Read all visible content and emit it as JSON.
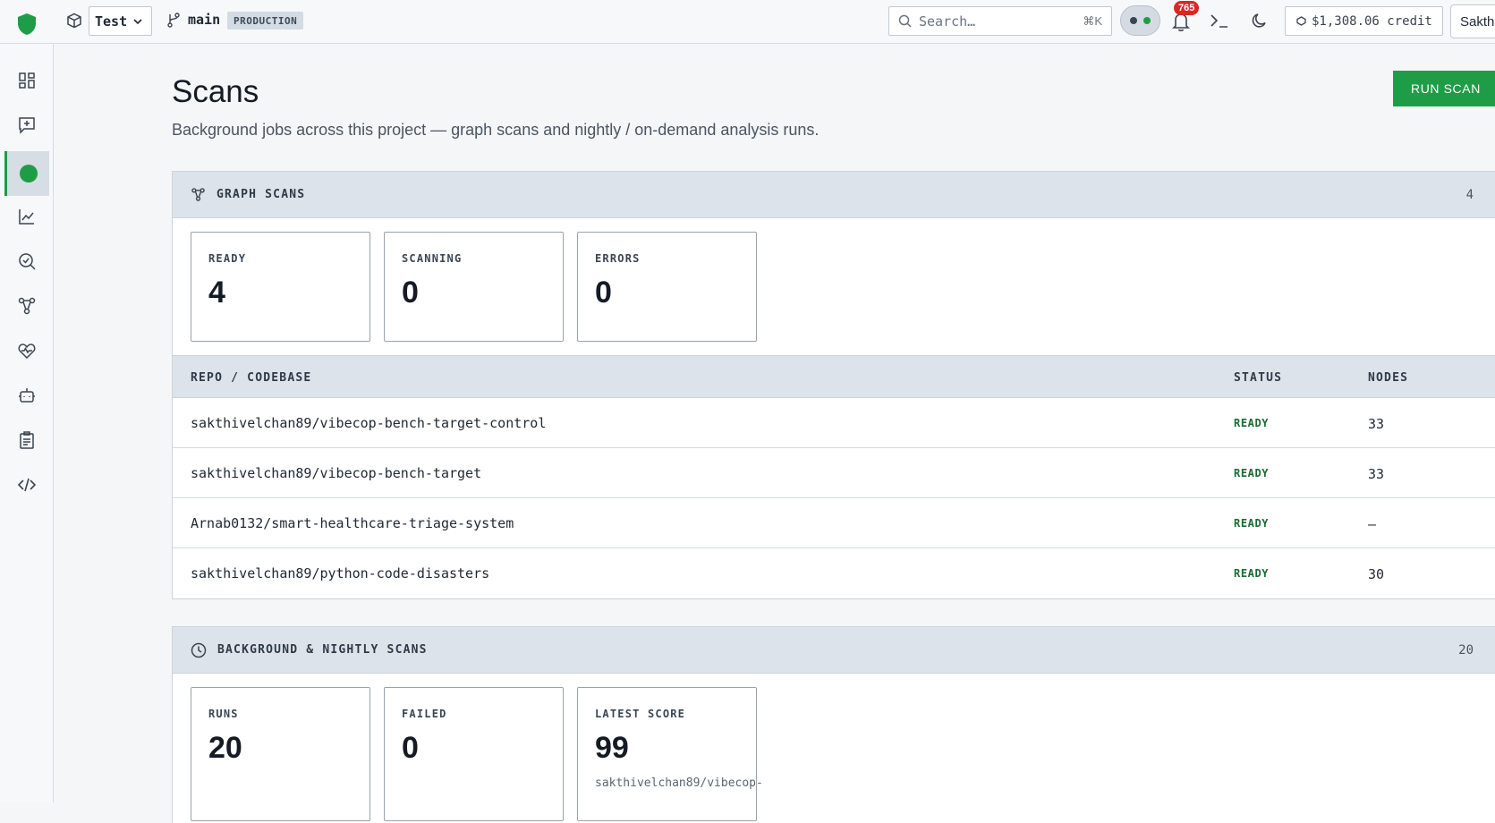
{
  "topbar": {
    "project": "Test",
    "branch": "main",
    "environment": "PRODUCTION",
    "search_placeholder": "Search…",
    "search_shortcut": "⌘K",
    "notification_count": "765",
    "credit": "$1,308.06 credit",
    "user": "Sakthi"
  },
  "page": {
    "title": "Scans",
    "subtitle": "Background jobs across this project — graph scans and nightly / on-demand analysis runs.",
    "run_button": "RUN SCAN"
  },
  "graph_scans": {
    "title": "GRAPH SCANS",
    "count": "4",
    "stats": [
      {
        "label": "READY",
        "value": "4"
      },
      {
        "label": "SCANNING",
        "value": "0"
      },
      {
        "label": "ERRORS",
        "value": "0"
      }
    ],
    "columns": {
      "repo": "REPO / CODEBASE",
      "status": "STATUS",
      "nodes": "NODES"
    },
    "rows": [
      {
        "repo": "sakthivelchan89/vibecop-bench-target-control",
        "status": "READY",
        "nodes": "33"
      },
      {
        "repo": "sakthivelchan89/vibecop-bench-target",
        "status": "READY",
        "nodes": "33"
      },
      {
        "repo": "Arnab0132/smart-healthcare-triage-system",
        "status": "READY",
        "nodes": "—"
      },
      {
        "repo": "sakthivelchan89/python-code-disasters",
        "status": "READY",
        "nodes": "30"
      }
    ]
  },
  "background_scans": {
    "title": "BACKGROUND & NIGHTLY SCANS",
    "count": "20",
    "stats": [
      {
        "label": "RUNS",
        "value": "20"
      },
      {
        "label": "FAILED",
        "value": "0"
      },
      {
        "label": "LATEST SCORE",
        "value": "99",
        "sub": "sakthivelchan89/vibecop-"
      }
    ]
  },
  "colors": {
    "accent": "#1f9d46",
    "status_ready": "#1a6b34",
    "badge": "#e02424"
  }
}
